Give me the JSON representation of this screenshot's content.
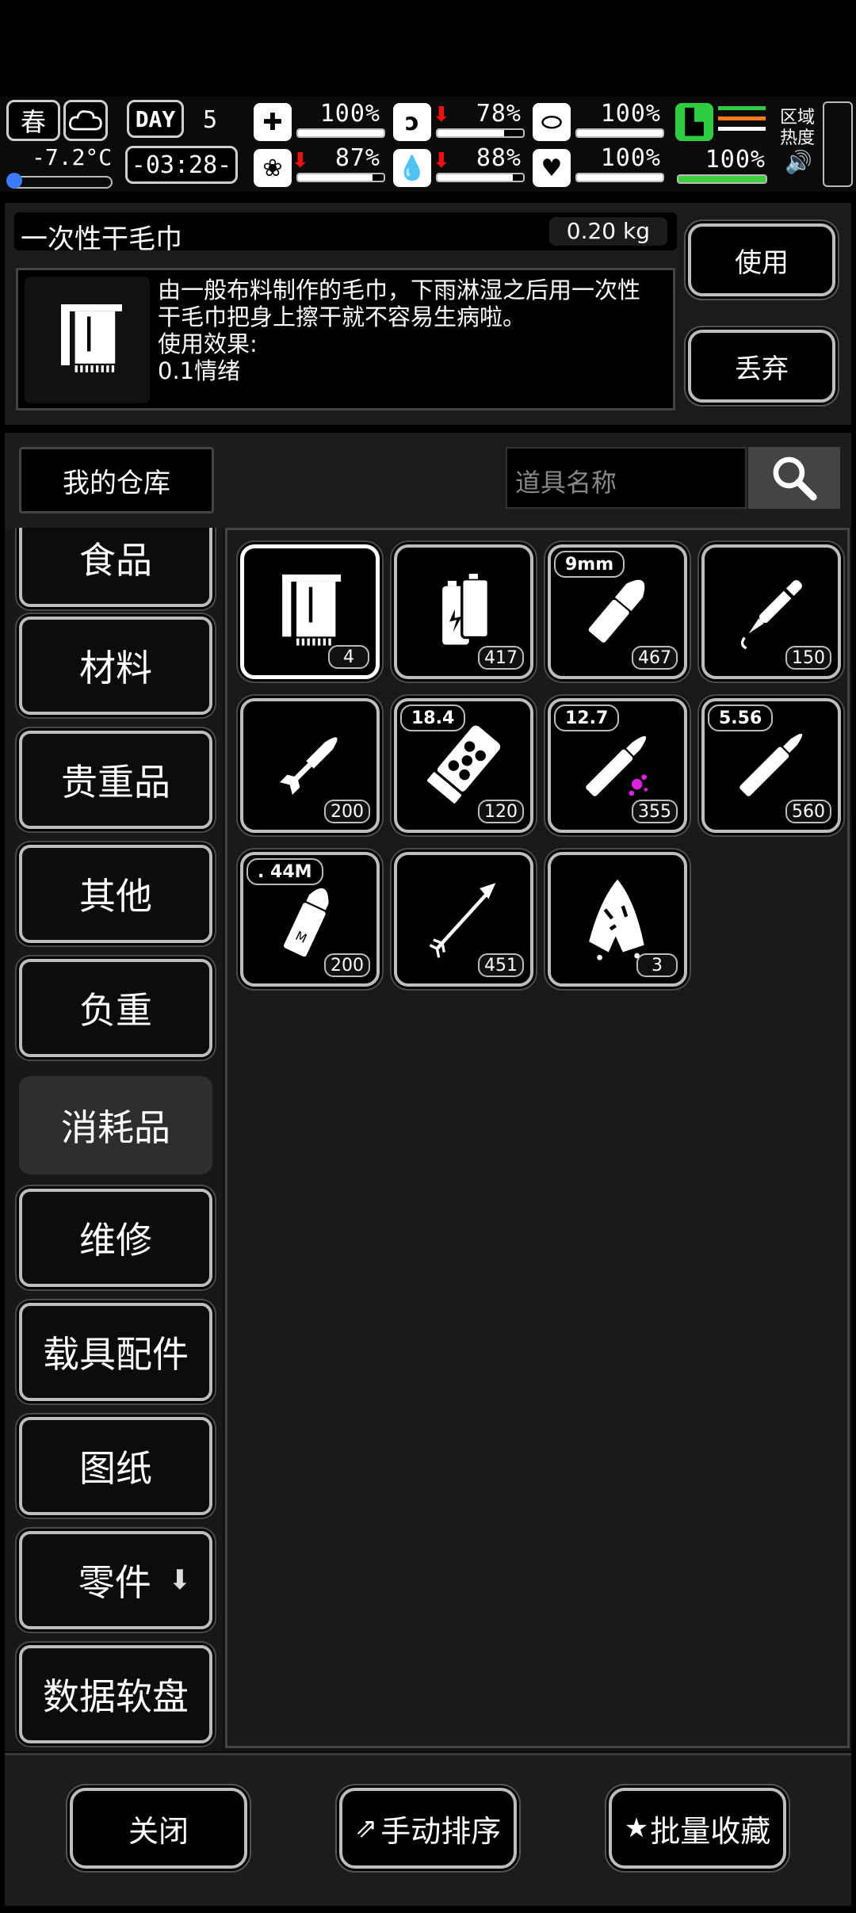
{
  "status": {
    "season": "春",
    "temperature": "-7.2°C",
    "day_label": "DAY",
    "day_number": "5",
    "clock": "-03:28-",
    "health": {
      "value": "100%",
      "fill": 1.0
    },
    "hunger": {
      "value": "78%",
      "fill": 0.78
    },
    "stomach": {
      "value": "100%",
      "fill": 1.0
    },
    "mood": {
      "value": "87%",
      "fill": 0.87
    },
    "thirst": {
      "value": "88%",
      "fill": 0.88
    },
    "heart": {
      "value": "100%",
      "fill": 1.0
    },
    "stamina": {
      "value": "100%",
      "fill": 1.0
    },
    "zone_heat": "区域热度"
  },
  "item": {
    "name": "一次性干毛巾",
    "weight": "0.20 kg",
    "description_line1": "由一般布料制作的毛巾，下雨淋湿之后用一次性",
    "description_line2": "干毛巾把身上擦干就不容易生病啦。",
    "effect_label": "使用效果:",
    "effect_value": "0.1情绪",
    "use_label": "使用",
    "discard_label": "丢弃"
  },
  "storage": {
    "title": "我的仓库",
    "search_placeholder": "道具名称"
  },
  "categories": [
    "食品",
    "材料",
    "贵重品",
    "其他",
    "负重",
    "消耗品",
    "维修",
    "载具配件",
    "图纸",
    "零件",
    "数据软盘"
  ],
  "active_category": "消耗品",
  "items": [
    {
      "icon": "towel-icon",
      "count": "4",
      "tag": ""
    },
    {
      "icon": "battery-icon",
      "count": "417",
      "tag": ""
    },
    {
      "icon": "bullet-9mm-icon",
      "count": "467",
      "tag": "9mm"
    },
    {
      "icon": "syringe-pen-icon",
      "count": "150",
      "tag": ""
    },
    {
      "icon": "rocket-icon",
      "count": "200",
      "tag": ""
    },
    {
      "icon": "shotgun-shell-icon",
      "count": "120",
      "tag": "18.4"
    },
    {
      "icon": "bullet-12-7-icon",
      "count": "355",
      "tag": "12.7"
    },
    {
      "icon": "bullet-5-56-icon",
      "count": "560",
      "tag": "5.56"
    },
    {
      "icon": "bullet-44m-icon",
      "count": "200",
      "tag": ". 44M"
    },
    {
      "icon": "arrow-icon",
      "count": "451",
      "tag": ""
    },
    {
      "icon": "cloth-icon",
      "count": "3",
      "tag": ""
    }
  ],
  "bottom": {
    "close": "关闭",
    "sort": "手动排序",
    "favorite": "批量收藏"
  }
}
